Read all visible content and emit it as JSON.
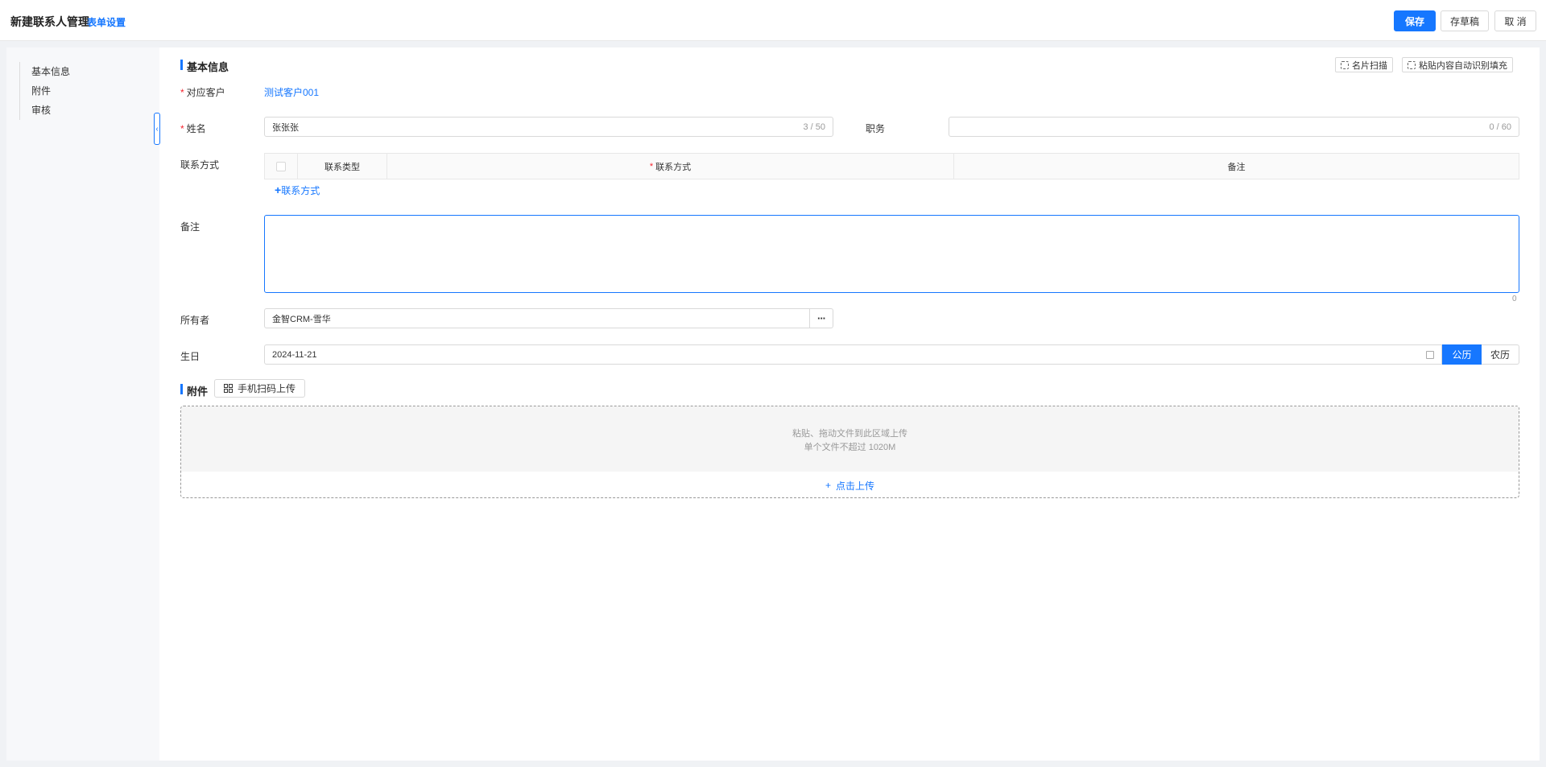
{
  "header": {
    "title": "新建联系人管理",
    "form_settings": "表单设置",
    "save": "保存",
    "draft": "存草稿",
    "cancel": "取 消"
  },
  "sidebar": {
    "items": [
      "基本信息",
      "附件",
      "审核"
    ]
  },
  "basic_info": {
    "section_title": "基本信息",
    "card_scan": "名片扫描",
    "paste_autofill": "粘贴内容自动识别填充",
    "customer_label": "对应客户",
    "customer_value": "测试客户001",
    "name_label": "姓名",
    "name_value": "张张张",
    "name_count": "3 / 50",
    "position_label": "职务",
    "position_count": "0 / 60",
    "contact_label": "联系方式",
    "contact_table_headers": [
      "联系类型",
      "联系方式",
      "备注"
    ],
    "add_contact": "联系方式",
    "remark_label": "备注",
    "remark_count": "0",
    "owner_label": "所有者",
    "owner_value": "金智CRM-雪华",
    "owner_more": "···",
    "birthday_label": "生日",
    "birthday_value": "2024-11-21",
    "solar": "公历",
    "lunar": "农历"
  },
  "attachments": {
    "section_title": "附件",
    "qr_upload": "手机扫码上传",
    "drop_hint": "粘贴、拖动文件到此区域上传",
    "size_hint": "单个文件不超过 1020M",
    "click_upload": "点击上传"
  },
  "colors": {
    "accent": "#1677ff",
    "required": "#f5222d"
  }
}
